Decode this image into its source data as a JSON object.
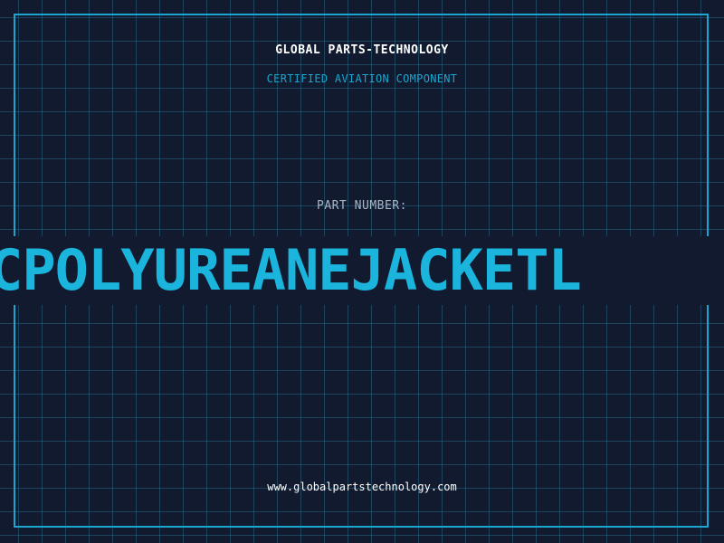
{
  "header": {
    "company": "GLOBAL PARTS-TECHNOLOGY",
    "subtitle": "CERTIFIED AVIATION COMPONENT"
  },
  "part": {
    "label": "PART NUMBER:",
    "value": "CPOLYUREANEJACKETL"
  },
  "footer": {
    "website": "www.globalpartstechnology.com"
  },
  "colors": {
    "background": "#111a2e",
    "accent": "#1aa6cf",
    "part_number": "#1ab4dc",
    "label": "#a9b6c7"
  }
}
